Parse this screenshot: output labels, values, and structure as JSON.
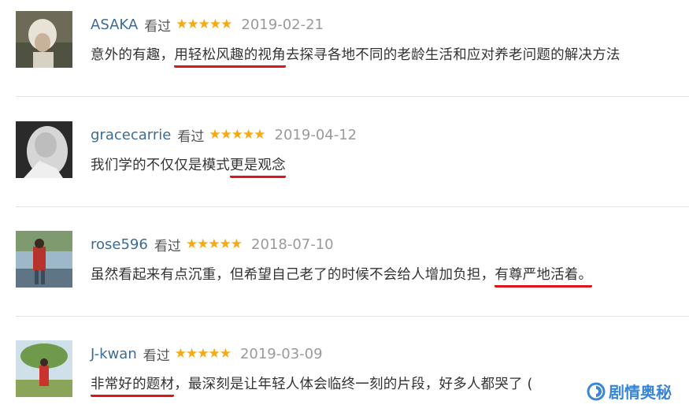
{
  "reviews": [
    {
      "username": "ASAKA",
      "watched": "看过",
      "stars": "★★★★★",
      "date": "2019-02-21",
      "comment": {
        "before": "意外的有趣，",
        "highlight": "用轻松风趣的视角",
        "after": "去探寻各地不同的老龄生活和应对养老问题的解决方法"
      }
    },
    {
      "username": "gracecarrie",
      "watched": "看过",
      "stars": "★★★★★",
      "date": "2019-04-12",
      "comment": {
        "before": "我们学的不仅仅是模式",
        "highlight": "更是观念",
        "after": ""
      }
    },
    {
      "username": "rose596",
      "watched": "看过",
      "stars": "★★★★★",
      "date": "2018-07-10",
      "comment": {
        "before": "虽然看起来有点沉重，但希望自己老了的时候不会给人增加负担，",
        "highlight": "有尊严地活着。",
        "after": ""
      }
    },
    {
      "username": "J-kwan",
      "watched": "看过",
      "stars": "★★★★★",
      "date": "2019-03-09",
      "comment": {
        "before": "",
        "highlight": "非常好的题材",
        "after": "，最深刻是让年轻人体会临终一刻的片段，好多人都哭了 ("
      }
    }
  ],
  "watermark": {
    "text": "剧情奥秘",
    "icon": "brand-swirl-icon"
  },
  "colors": {
    "username": "#3d6b94",
    "stars": "#f6a915",
    "highlight_underline": "#d9161b",
    "watermark": "#3a86d4"
  }
}
